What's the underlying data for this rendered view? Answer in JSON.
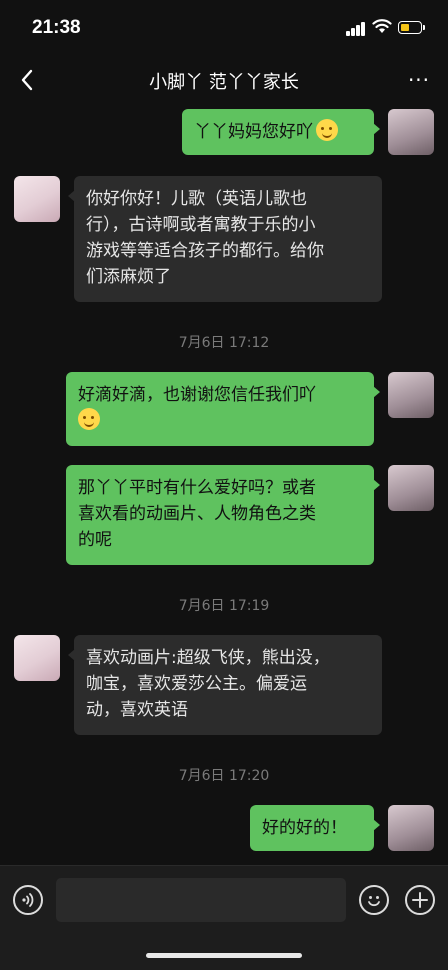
{
  "status_bar": {
    "time": "21:38",
    "battery_color": "#f5c518"
  },
  "header": {
    "title": "小脚丫 范丫丫家长",
    "back_icon": "chevron-left-icon",
    "more_icon": "more-dots-icon",
    "more_label": "···"
  },
  "messages": [
    {
      "sender": "me",
      "lines": [
        "丫丫妈妈您好吖"
      ],
      "emoji": "smile-emoji"
    },
    {
      "sender": "them",
      "lines": [
        "你好你好！儿歌（英语儿歌也",
        "行），古诗啊或者寓教于乐的小",
        "游戏等等适合孩子的都行。给你",
        "们添麻烦了"
      ]
    },
    {
      "timestamp": "7月6日 17:12"
    },
    {
      "sender": "me",
      "lines": [
        "好滴好滴，也谢谢您信任我们吖"
      ],
      "emoji": "smile-emoji"
    },
    {
      "sender": "me",
      "lines": [
        "那丫丫平时有什么爱好吗？或者",
        "喜欢看的动画片、人物角色之类",
        "的呢"
      ]
    },
    {
      "timestamp": "7月6日 17:19"
    },
    {
      "sender": "them",
      "lines": [
        "喜欢动画片:超级飞侠，熊出没，",
        "咖宝，喜欢爱莎公主。偏爱运",
        "动，喜欢英语"
      ]
    },
    {
      "timestamp": "7月6日 17:20"
    },
    {
      "sender": "me",
      "lines": [
        "好的好的！"
      ]
    }
  ],
  "colors": {
    "my_bubble": "#5fc25f",
    "their_bubble": "#2c2c2c",
    "background": "#111111"
  },
  "input_bar": {
    "voice_icon": "voice-icon",
    "input_value": "",
    "emoji_icon": "emoji-icon",
    "plus_icon": "plus-icon"
  }
}
